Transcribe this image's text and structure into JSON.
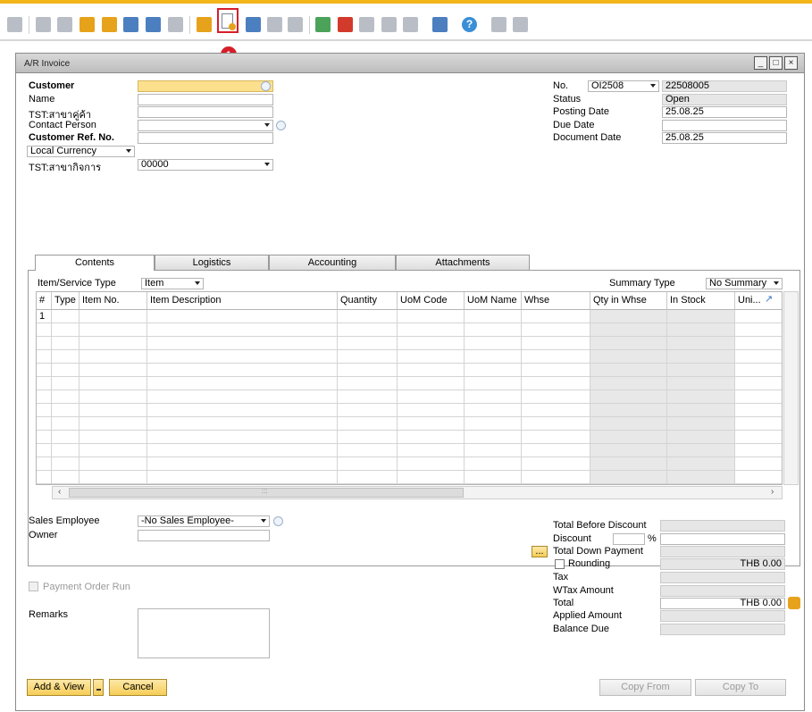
{
  "badge": "1",
  "window": {
    "title": "A/R Invoice"
  },
  "header_left": {
    "customer_label": "Customer",
    "name_label": "Name",
    "tst_customer_branch_label": "TST:สาขาคู่ค้า",
    "contact_person_label": "Contact Person",
    "customer_ref_label": "Customer Ref. No.",
    "currency_value": "Local Currency",
    "tst_business_branch_label": "TST:สาขากิจการ",
    "tst_business_branch_value": "00000"
  },
  "header_right": {
    "no_label": "No.",
    "series_value": "OI2508",
    "doc_number": "22508005",
    "status_label": "Status",
    "status_value": "Open",
    "posting_date_label": "Posting Date",
    "posting_date_value": "25.08.25",
    "due_date_label": "Due Date",
    "due_date_value": "",
    "document_date_label": "Document Date",
    "document_date_value": "25.08.25"
  },
  "tabs": [
    {
      "label": "Contents"
    },
    {
      "label": "Logistics"
    },
    {
      "label": "Accounting"
    },
    {
      "label": "Attachments"
    }
  ],
  "contents": {
    "item_service_type_label": "Item/Service Type",
    "item_service_type_value": "Item",
    "summary_type_label": "Summary Type",
    "summary_type_value": "No Summary",
    "columns": [
      "#",
      "Type",
      "Item No.",
      "Item Description",
      "Quantity",
      "UoM Code",
      "UoM Name",
      "Whse",
      "Qty in Whse",
      "In Stock",
      "Uni..."
    ],
    "first_row_number": "1",
    "hscroll_grip": ":::"
  },
  "footer_left": {
    "sales_employee_label": "Sales Employee",
    "sales_employee_value": "-No Sales Employee-",
    "owner_label": "Owner",
    "payment_order_run_label": "Payment Order Run",
    "remarks_label": "Remarks"
  },
  "footer_right": {
    "total_before_discount_label": "Total Before Discount",
    "discount_label": "Discount",
    "percent_sign": "%",
    "ellipsis_button": "...",
    "total_down_payment_label": "Total Down Payment",
    "rounding_label": "Rounding",
    "rounding_value": "THB 0.00",
    "tax_label": "Tax",
    "wtax_amount_label": "WTax Amount",
    "total_label": "Total",
    "total_value": "THB 0.00",
    "applied_amount_label": "Applied Amount",
    "balance_due_label": "Balance Due"
  },
  "buttons": {
    "add_view": "Add & View",
    "cancel": "Cancel",
    "copy_from": "Copy From",
    "copy_to": "Copy To"
  },
  "colors": {
    "accent_top": "#f2b51a",
    "highlight_red": "#d61f2b",
    "mandatory_field": "#fde08d"
  }
}
